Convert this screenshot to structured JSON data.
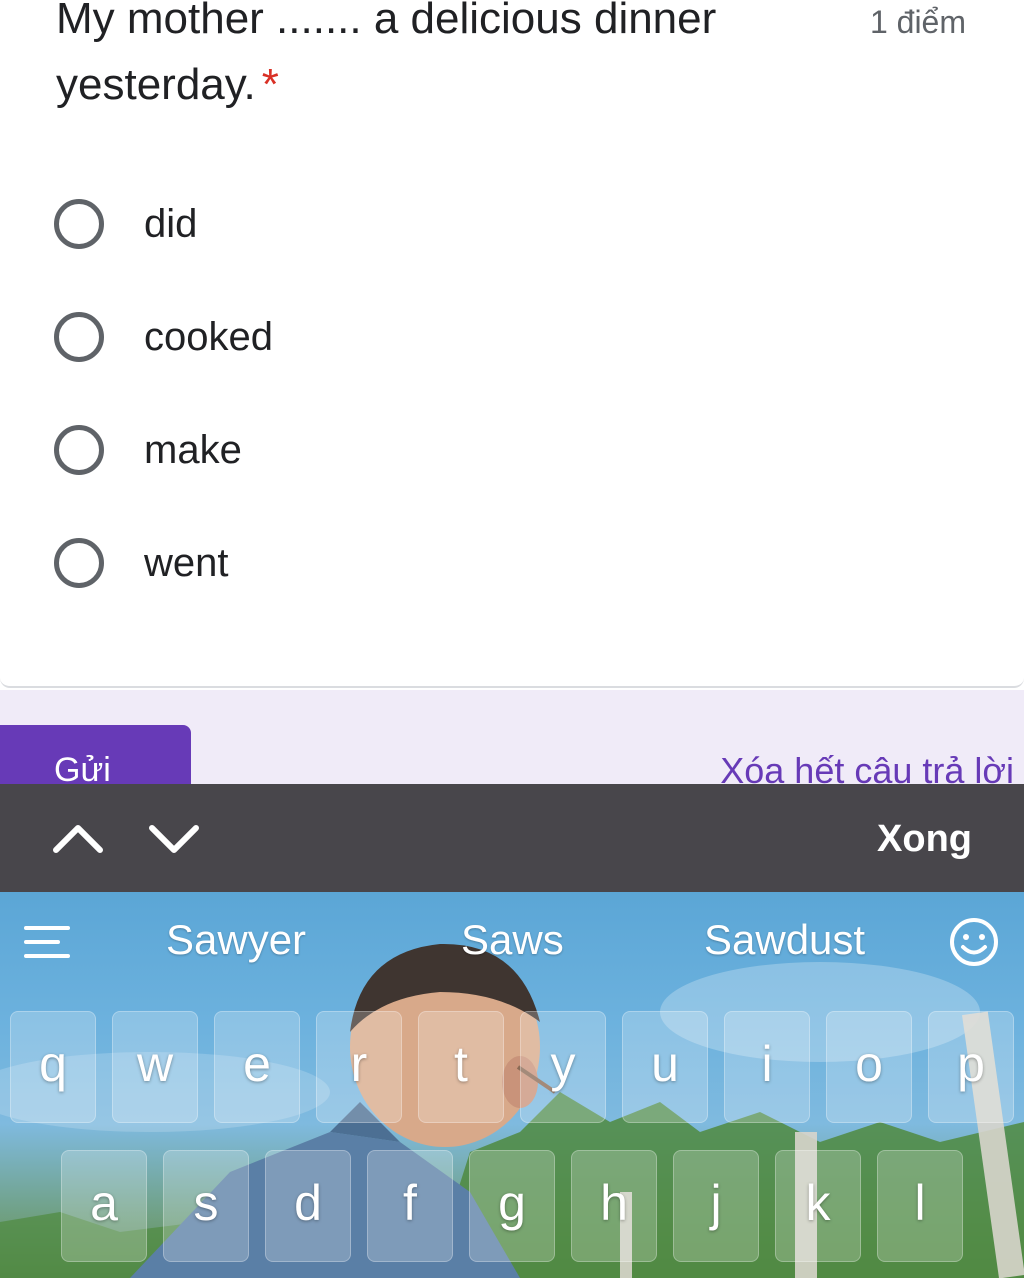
{
  "question": {
    "text": "My mother ....... a delicious dinner yesterday.",
    "required_marker": "*",
    "points": "1 điểm"
  },
  "options": [
    {
      "label": "did"
    },
    {
      "label": "cooked"
    },
    {
      "label": "make"
    },
    {
      "label": "went"
    }
  ],
  "footer": {
    "submit_label": "Gửi",
    "clear_label": "Xóa hết câu trả lời"
  },
  "accessory_bar": {
    "up_icon": "chevron-up-icon",
    "down_icon": "chevron-down-icon",
    "done_label": "Xong"
  },
  "keyboard": {
    "suggestions": [
      "Sawyer",
      "Saws",
      "Sawdust"
    ],
    "row1": [
      "q",
      "w",
      "e",
      "r",
      "t",
      "y",
      "u",
      "i",
      "o",
      "p"
    ],
    "row2": [
      "a",
      "s",
      "d",
      "f",
      "g",
      "h",
      "j",
      "k",
      "l"
    ]
  },
  "colors": {
    "accent": "#673ab7",
    "required": "#d93025",
    "footer_bg": "#f0ebf8",
    "accessory_bg": "#48464b"
  }
}
